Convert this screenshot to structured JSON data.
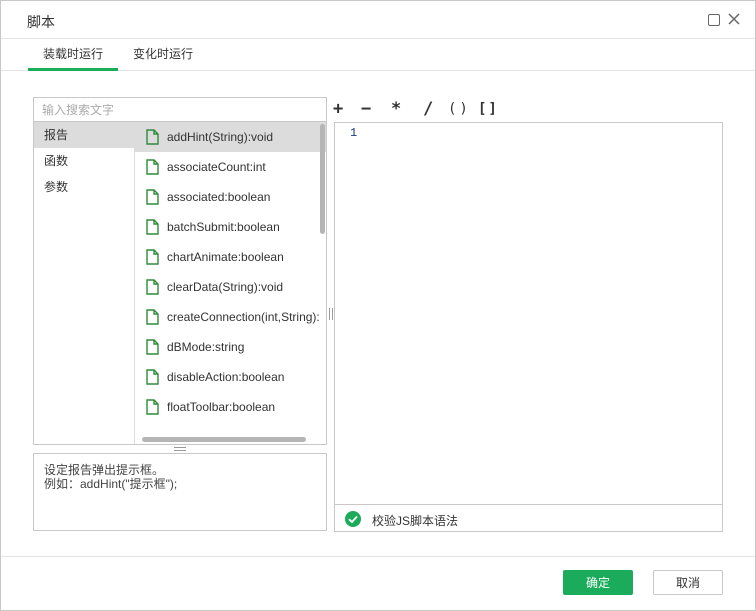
{
  "dialog": {
    "title": "脚本"
  },
  "tabs": [
    {
      "label": "装载时运行",
      "active": true
    },
    {
      "label": "变化时运行",
      "active": false
    }
  ],
  "search": {
    "placeholder": "输入搜索文字",
    "value": ""
  },
  "categories": [
    {
      "label": "报告",
      "selected": true
    },
    {
      "label": "函数",
      "selected": false
    },
    {
      "label": "参数",
      "selected": false
    }
  ],
  "functions": [
    {
      "label": "addHint(String):void",
      "selected": true
    },
    {
      "label": "associateCount:int"
    },
    {
      "label": "associated:boolean"
    },
    {
      "label": "batchSubmit:boolean"
    },
    {
      "label": "chartAnimate:boolean"
    },
    {
      "label": "clearData(String):void"
    },
    {
      "label": "createConnection(int,String):"
    },
    {
      "label": "dBMode:string"
    },
    {
      "label": "disableAction:boolean"
    },
    {
      "label": "floatToolbar:boolean"
    }
  ],
  "description": {
    "line1": "设定报告弹出提示框。",
    "line2": "例如：addHint(\"提示框\");"
  },
  "operators": {
    "plus": "+",
    "minus": "−",
    "multiply": "*",
    "divide": "/",
    "paren": "()",
    "bracket": "[]"
  },
  "editor": {
    "line_number": "1"
  },
  "validate": {
    "label": "校验JS脚本语法"
  },
  "footer": {
    "ok_label": "确定",
    "cancel_label": "取消"
  },
  "colors": {
    "accent": "#1aac5a",
    "icon": "#2e8b3a",
    "selected_bg": "#dcdcdc"
  }
}
